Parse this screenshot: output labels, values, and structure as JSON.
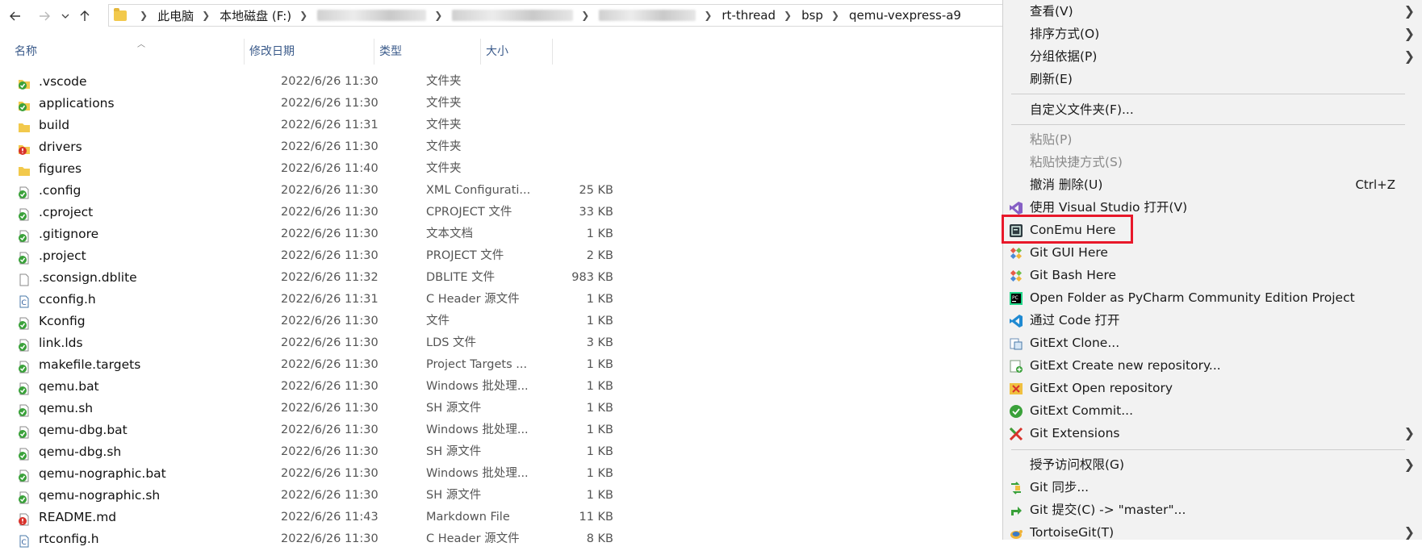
{
  "nav": {
    "back_icon": "arrow-left-icon",
    "forward_icon": "arrow-right-icon",
    "recent_icon": "chevron-down-icon",
    "up_icon": "arrow-up-icon"
  },
  "address": {
    "crumbs": [
      "此电脑",
      "本地磁盘 (F:)",
      "rt-thread",
      "bsp",
      "qemu-vexpress-a9"
    ]
  },
  "columns": {
    "name": "名称",
    "date": "修改日期",
    "type": "类型",
    "size": "大小"
  },
  "files": [
    {
      "name": ".vscode",
      "date": "2022/6/26 11:30",
      "type": "文件夹",
      "size": "",
      "icon": "folder-synced-icon"
    },
    {
      "name": "applications",
      "date": "2022/6/26 11:30",
      "type": "文件夹",
      "size": "",
      "icon": "folder-synced-icon"
    },
    {
      "name": "build",
      "date": "2022/6/26 11:31",
      "type": "文件夹",
      "size": "",
      "icon": "folder-icon"
    },
    {
      "name": "drivers",
      "date": "2022/6/26 11:30",
      "type": "文件夹",
      "size": "",
      "icon": "folder-modified-icon"
    },
    {
      "name": "figures",
      "date": "2022/6/26 11:40",
      "type": "文件夹",
      "size": "",
      "icon": "folder-icon"
    },
    {
      "name": ".config",
      "date": "2022/6/26 11:30",
      "type": "XML Configurati...",
      "size": "25 KB",
      "icon": "file-synced-icon"
    },
    {
      "name": ".cproject",
      "date": "2022/6/26 11:30",
      "type": "CPROJECT 文件",
      "size": "33 KB",
      "icon": "file-synced-icon"
    },
    {
      "name": ".gitignore",
      "date": "2022/6/26 11:30",
      "type": "文本文档",
      "size": "1 KB",
      "icon": "file-synced-icon"
    },
    {
      "name": ".project",
      "date": "2022/6/26 11:30",
      "type": "PROJECT 文件",
      "size": "2 KB",
      "icon": "file-synced-icon"
    },
    {
      "name": ".sconsign.dblite",
      "date": "2022/6/26 11:32",
      "type": "DBLITE 文件",
      "size": "983 KB",
      "icon": "file-icon"
    },
    {
      "name": "cconfig.h",
      "date": "2022/6/26 11:31",
      "type": "C Header 源文件",
      "size": "1 KB",
      "icon": "c-header-file-icon"
    },
    {
      "name": "Kconfig",
      "date": "2022/6/26 11:30",
      "type": "文件",
      "size": "1 KB",
      "icon": "file-synced-icon"
    },
    {
      "name": "link.lds",
      "date": "2022/6/26 11:30",
      "type": "LDS 文件",
      "size": "3 KB",
      "icon": "file-synced-icon"
    },
    {
      "name": "makefile.targets",
      "date": "2022/6/26 11:30",
      "type": "Project Targets ...",
      "size": "1 KB",
      "icon": "file-synced-icon"
    },
    {
      "name": "qemu.bat",
      "date": "2022/6/26 11:30",
      "type": "Windows 批处理...",
      "size": "1 KB",
      "icon": "file-synced-icon"
    },
    {
      "name": "qemu.sh",
      "date": "2022/6/26 11:30",
      "type": "SH 源文件",
      "size": "1 KB",
      "icon": "file-synced-icon"
    },
    {
      "name": "qemu-dbg.bat",
      "date": "2022/6/26 11:30",
      "type": "Windows 批处理...",
      "size": "1 KB",
      "icon": "file-synced-icon"
    },
    {
      "name": "qemu-dbg.sh",
      "date": "2022/6/26 11:30",
      "type": "SH 源文件",
      "size": "1 KB",
      "icon": "file-synced-icon"
    },
    {
      "name": "qemu-nographic.bat",
      "date": "2022/6/26 11:30",
      "type": "Windows 批处理...",
      "size": "1 KB",
      "icon": "file-synced-icon"
    },
    {
      "name": "qemu-nographic.sh",
      "date": "2022/6/26 11:30",
      "type": "SH 源文件",
      "size": "1 KB",
      "icon": "file-synced-icon"
    },
    {
      "name": "README.md",
      "date": "2022/6/26 11:43",
      "type": "Markdown File",
      "size": "11 KB",
      "icon": "file-modified-icon"
    },
    {
      "name": "rtconfig.h",
      "date": "2022/6/26 11:30",
      "type": "C Header 源文件",
      "size": "8 KB",
      "icon": "c-header-file-icon"
    }
  ],
  "menu": {
    "view": "查看(V)",
    "sort": "排序方式(O)",
    "group": "分组依据(P)",
    "refresh": "刷新(E)",
    "customize": "自定义文件夹(F)...",
    "paste": "粘贴(P)",
    "paste_shortcut": "粘贴快捷方式(S)",
    "undo": "撤消 删除(U)",
    "undo_accel": "Ctrl+Z",
    "vs_open": "使用 Visual Studio 打开(V)",
    "conemu": "ConEmu Here",
    "git_gui": "Git GUI Here",
    "git_bash": "Git Bash Here",
    "pycharm": "Open Folder as PyCharm Community Edition Project",
    "vscode_open": "通过 Code 打开",
    "gitext_clone": "GitExt Clone...",
    "gitext_create": "GitExt Create new repository...",
    "gitext_open": "GitExt Open repository",
    "gitext_commit": "GitExt Commit...",
    "git_extensions": "Git Extensions",
    "grant_access": "授予访问权限(G)",
    "git_sync": "Git 同步...",
    "git_commit": "Git 提交(C) -> \"master\"...",
    "tortoisegit": "TortoiseGit(T)"
  },
  "colors": {
    "highlight_box": "#e8182a",
    "header_text": "#3a5a8a",
    "folder": "#f2c94c",
    "sync_green": "#3aa13a",
    "modified_red": "#d8322b"
  }
}
